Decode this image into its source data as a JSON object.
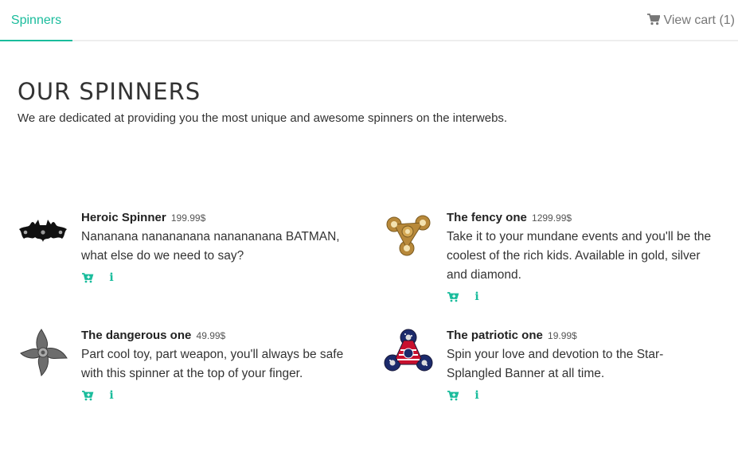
{
  "nav": {
    "tab_label": "Spinners",
    "cart_label": "View cart (1)",
    "cart_icon": "shopping-cart-icon",
    "accent_color": "#1abc9c"
  },
  "header": {
    "title": "OUR SPINNERS",
    "subtitle": "We are dedicated at providing you the most unique and awesome spinners on the interwebs."
  },
  "products": [
    {
      "name": "Heroic Spinner",
      "price": "199.99$",
      "description": "Nananana nanananana nanananana BATMAN, what else do we need to say?",
      "image": "batman-spinner-image"
    },
    {
      "name": "The fency one",
      "price": "1299.99$",
      "description": "Take it to your mundane events and you'll be the coolest of the rich kids. Available in gold, silver and diamond.",
      "image": "gold-spinner-image"
    },
    {
      "name": "The dangerous one",
      "price": "49.99$",
      "description": "Part cool toy, part weapon, you'll always be safe with this spinner at the top of your finger.",
      "image": "blade-spinner-image"
    },
    {
      "name": "The patriotic one",
      "price": "19.99$",
      "description": "Spin your love and devotion to the Star-Splangled Banner at all time.",
      "image": "flag-spinner-image"
    }
  ]
}
